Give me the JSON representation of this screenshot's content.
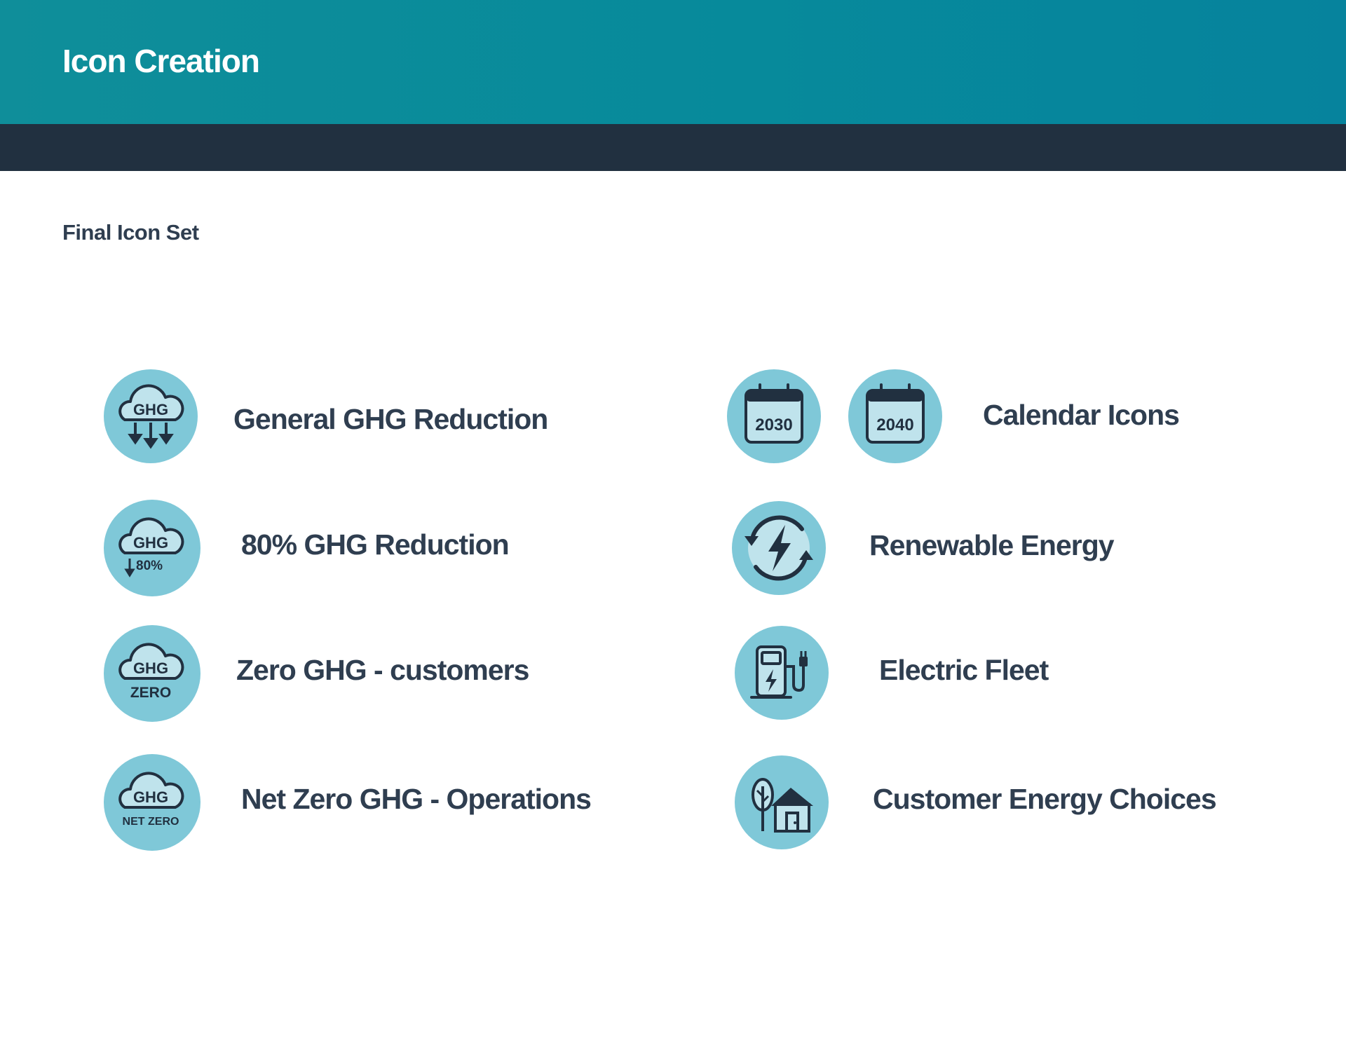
{
  "header": {
    "title": "Icon Creation"
  },
  "section": {
    "title": "Final Icon Set"
  },
  "icons": {
    "general_ghg": {
      "icon_text": "GHG",
      "label": "General GHG Reduction"
    },
    "ghg_80": {
      "icon_text": "GHG",
      "icon_subtext": "80%",
      "label": "80% GHG Reduction"
    },
    "zero_ghg": {
      "icon_text": "GHG",
      "icon_subtext": "ZERO",
      "label": "Zero GHG - customers"
    },
    "net_zero": {
      "icon_text": "GHG",
      "icon_subtext": "NET ZERO",
      "label": "Net Zero GHG - Operations"
    },
    "calendar": {
      "year_1": "2030",
      "year_2": "2040",
      "label": "Calendar Icons"
    },
    "renewable": {
      "label": "Renewable Energy"
    },
    "electric_fleet": {
      "label": "Electric Fleet"
    },
    "customer_choices": {
      "label": "Customer Energy Choices"
    }
  },
  "colors": {
    "header_teal": "#078a9b",
    "header_dark": "#213040",
    "icon_circle": "#7fc8d8",
    "icon_stroke": "#213040",
    "text": "#2f3e50"
  }
}
